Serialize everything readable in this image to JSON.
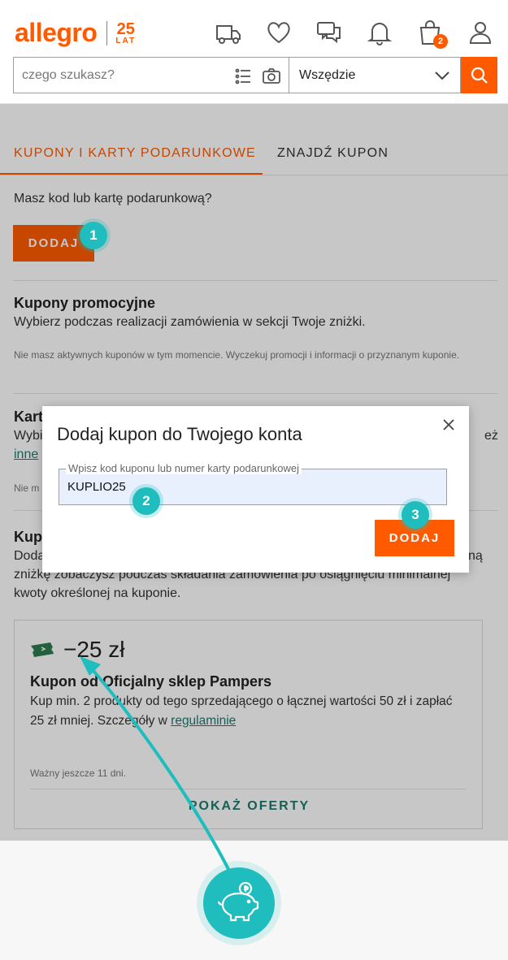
{
  "header": {
    "logo_text": "allegro",
    "logo_badge_number": "25",
    "logo_badge_text": "LAT",
    "cart_badge": "2",
    "icons": [
      "truck-icon",
      "heart-icon",
      "chat-icon",
      "bell-icon",
      "bag-icon",
      "user-icon"
    ]
  },
  "search": {
    "placeholder": "czego szukasz?",
    "scope_value": "Wszędzie"
  },
  "tabs": [
    {
      "label": "KUPONY I KARTY PODARUNKOWE",
      "active": true
    },
    {
      "label": "ZNAJDŹ KUPON",
      "active": false
    }
  ],
  "add_section": {
    "question": "Masz kod lub kartę podarunkową?",
    "button": "DODAJ"
  },
  "promo_section": {
    "title": "Kupony promocyjne",
    "text": "Wybierz podczas realizacji zamówienia w sekcji Twoje zniżki.",
    "note": "Nie masz aktywnych kuponów w tym momencie. Wyczekuj promocji i informacji o przyznanym kuponie."
  },
  "cards_section": {
    "title_partial": "Kart",
    "text_partial": "Wybi",
    "text_tail": "eż",
    "link_partial": "inne",
    "note_partial": "Nie m"
  },
  "seller_section": {
    "title_partial": "Kup",
    "line1_start": "Doda",
    "line1_end": "ną",
    "line2": "zniżkę zobaczysz podczas składania zamówienia po osiągnięciu minimalnej",
    "line3": "kwoty określonej na kuponie."
  },
  "coupon": {
    "amount": "−25 zł",
    "title": "Kupon od Oficjalny sklep Pampers",
    "text": "Kup min. 2 produkty od tego sprzedającego o łącznej wartości 50 zł i zapłać 25 zł mniej. Szczegóły w",
    "link": "regulaminie",
    "validity": "Ważny jeszcze 11 dni.",
    "button": "POKAŻ OFERTY"
  },
  "modal": {
    "title": "Dodaj kupon do Twojego konta",
    "field_label": "Wpisz kod kuponu lub numer karty podarunkowej",
    "field_value": "KUPLIO25",
    "button": "DODAJ"
  },
  "markers": [
    "1",
    "2",
    "3"
  ],
  "colors": {
    "brand": "#ff5a00",
    "teal": "#1fbdbd",
    "link": "#1d7a6f"
  }
}
